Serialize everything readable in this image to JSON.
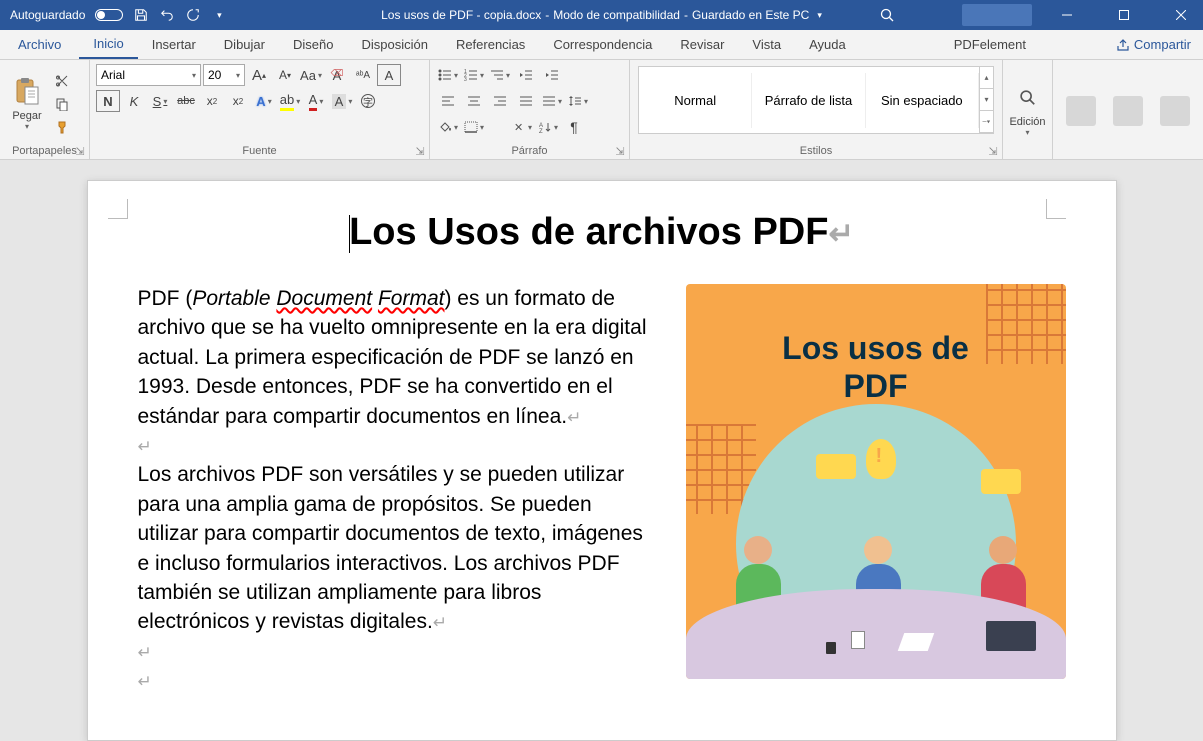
{
  "titlebar": {
    "autosave": "Autoguardado",
    "doc_name": "Los usos de PDF - copia.docx",
    "mode": "Modo de compatibilidad",
    "saved": "Guardado en Este PC"
  },
  "tabs": {
    "file": "Archivo",
    "home": "Inicio",
    "insert": "Insertar",
    "draw": "Dibujar",
    "design": "Diseño",
    "layout": "Disposición",
    "references": "Referencias",
    "mailings": "Correspondencia",
    "review": "Revisar",
    "view": "Vista",
    "help": "Ayuda",
    "addin": "",
    "pdfelement": "PDFelement",
    "share": "Compartir"
  },
  "ribbon": {
    "clipboard": {
      "label": "Portapapeles",
      "paste": "Pegar"
    },
    "font": {
      "label": "Fuente",
      "name": "Arial",
      "size": "20",
      "bold": "N",
      "italic": "K",
      "underline": "S",
      "strike": "abc",
      "sub": "x₂",
      "sup": "x²",
      "casechg": "Aa",
      "bigA": "A",
      "smallA": "A"
    },
    "paragraph": {
      "label": "Párrafo"
    },
    "styles": {
      "label": "Estilos",
      "items": [
        "Normal",
        "Párrafo de lista",
        "Sin espaciado"
      ]
    },
    "editing": {
      "label": "Edición"
    }
  },
  "document": {
    "title": "Los Usos de archivos PDF",
    "para1_a": "PDF (",
    "para1_b": "Portable ",
    "para1_c": "Document",
    "para1_d": " ",
    "para1_e": "Format",
    "para1_f": ") es un formato de archivo que se ha vuelto omnipresente en la era digital actual. La primera especificación de PDF se lanzó en 1993. Desde entonces, PDF se ha convertido en el estándar para compartir documentos en línea.",
    "para2": "Los archivos PDF son versátiles y se pueden utilizar para una amplia gama de propósitos. Se pueden utilizar para compartir documentos de texto, imágenes e incluso formularios interactivos. Los archivos PDF también se utilizan ampliamente para libros electrónicos y revistas digitales.",
    "image_title_l1": "Los usos de",
    "image_title_l2": "PDF"
  }
}
